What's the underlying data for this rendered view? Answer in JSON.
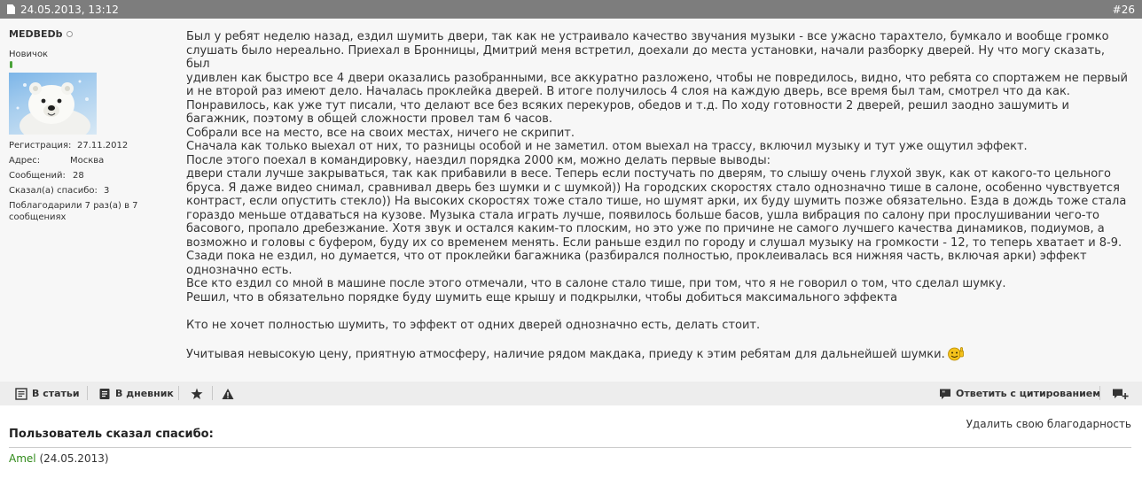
{
  "header": {
    "date": "24.05.2013, 13:12",
    "post_number": "#26"
  },
  "user": {
    "name": "MEDBEDb",
    "title": "Новичок",
    "registration_label": "Регистрация:",
    "registration_value": "27.11.2012",
    "address_label": "Адрес:",
    "address_value": "Москва",
    "posts_label": "Сообщений:",
    "posts_value": "28",
    "said_thanks_label": "Сказал(а) спасибо:",
    "said_thanks_value": "3",
    "thanked_line1": "Поблагодарили 7 раз(а) в 7",
    "thanked_line2": "сообщениях"
  },
  "message": {
    "lines": [
      "Был у ребят неделю назад, ездил шумить двери, так как не устраивало качество звучания музыки - все ужасно тарахтело, бумкало и вообще громко",
      "слушать было нереально. Приехал в Бронницы, Дмитрий меня встретил, доехали до места установки, начали разборку дверей. Ну что могу сказать, был",
      "удивлен как быстро все 4 двери оказались разобранными, все аккуратно разложено, чтобы не повредилось, видно, что ребята со спортажем не первый",
      "и не второй раз имеют дело. Началась проклейка дверей. В итоге получилось 4 слоя на каждую дверь, все время был там, смотрел что да как.",
      "Понравилось, как уже тут писали, что делают все без всяких перекуров, обедов и т.д. По ходу готовности 2 дверей, решил заодно зашумить и",
      "багажник, поэтому в общей сложности провел там 6 часов.",
      "Собрали все на место, все на своих местах, ничего не скрипит.",
      "Сначала как только выехал от них, то разницы особой и не заметил. отом выехал на трассу, включил музыку и тут уже ощутил эффект.",
      "После этого поехал в командировку, наездил порядка 2000 км, можно делать первые выводы:",
      "двери стали лучше закрываться, так как прибавили в весе. Теперь если постучать по дверям, то слышу очень глухой звук, как от какого-то цельного",
      "бруса. Я даже видео снимал, сравнивал дверь без шумки и с шумкой)) На городских скоростях стало однозначно тише в салоне, особенно чувствуется",
      "контраст, если опустить стекло)) На высоких скоростях тоже стало тише, но шумят арки, их буду шумить позже обязательно. Езда в дождь тоже стала",
      "гораздо меньше отдаваться на кузове. Музыка стала играть лучше, появилось больше басов, ушла вибрация по салону при прослушивании чего-то",
      "басового, пропало дребезжание. Хотя звук и остался каким-то плоским, но это уже по причине не самого лучшего качества динамиков, подиумов, а",
      "возможно и головы с буфером, буду их со временем менять. Если раньше ездил по городу и слушал музыку на громкости - 12, то теперь хватает и 8-9.",
      "Сзади пока не ездил, но думается, что от проклейки багажника (разбирался полностью, проклеивалась вся нижняя часть, включая арки) эффект",
      "однозначно есть.",
      "Все кто ездил со мной в машине после этого отмечали, что в салоне стало тише, при том, что я не говорил о том, что сделал шумку.",
      "Решил, что в обязательно порядке буду шумить еще крышу и подкрылки, чтобы добиться максимального эффекта",
      "",
      "Кто не хочет полностью шумить, то эффект от одних дверей однозначно есть, делать стоит.",
      "",
      "Учитывая невысокую цену, приятную атмосферу, наличие рядом макдака, приеду к этим ребятам для дальнейшей шумки."
    ]
  },
  "footer": {
    "to_articles": "В статьи",
    "to_diary": "В дневник",
    "reply_quote": "Ответить с цитированием"
  },
  "thanks": {
    "remove_label": "Удалить свою благодарность",
    "title": "Пользователь сказал спасибо:",
    "user_name": "Amel",
    "user_date": "(24.05.2013)"
  }
}
